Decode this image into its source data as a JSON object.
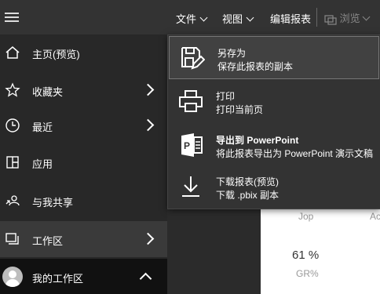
{
  "topbar": {
    "file_label": "文件",
    "view_label": "视图",
    "edit_report_label": "编辑报表",
    "browse_label": "浏览"
  },
  "sidebar": {
    "items": [
      {
        "label": "主页(预览)",
        "icon": "home-icon"
      },
      {
        "label": "收藏夹",
        "icon": "star-icon"
      },
      {
        "label": "最近",
        "icon": "clock-icon"
      },
      {
        "label": "应用",
        "icon": "apps-icon"
      },
      {
        "label": "与我共享",
        "icon": "share-icon"
      },
      {
        "label": "工作区",
        "icon": "workspaces-icon"
      }
    ],
    "my_workspace": "我的工作区"
  },
  "file_menu": {
    "items": [
      {
        "title": "另存为",
        "desc": "保存此报表的副本",
        "icon": "save-as-icon"
      },
      {
        "title": "打印",
        "desc": "打印当前页",
        "icon": "printer-icon"
      },
      {
        "title": "导出到 PowerPoint",
        "desc": "将此报表导出为 PowerPoint 演示文稿",
        "icon": "powerpoint-icon"
      },
      {
        "title": "下载报表(预览)",
        "desc": "下载 .pbix 副本",
        "icon": "download-icon"
      }
    ]
  },
  "report": {
    "col1": "Jop",
    "col2": "Ac",
    "value": "61 %",
    "metric": "GR%"
  },
  "colors": {
    "accent": "#f2c811",
    "topbar": "#333333",
    "sidebar": "#282828"
  }
}
